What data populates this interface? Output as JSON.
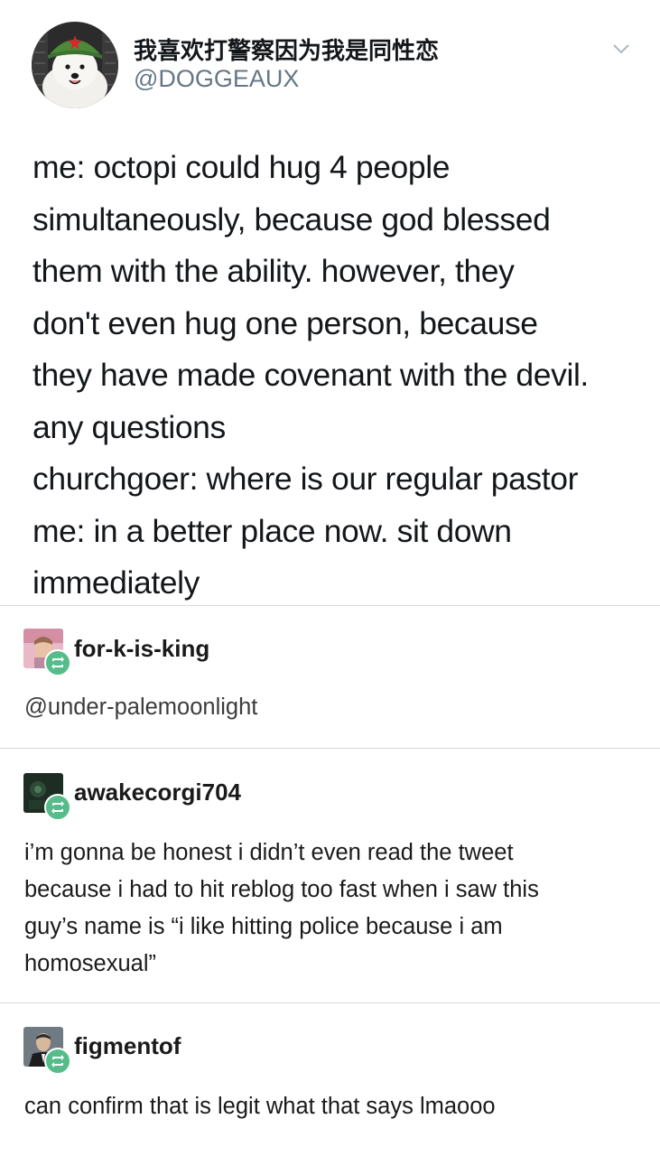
{
  "tweet": {
    "display_name": "我喜欢打警察因为我是同性恋",
    "handle": "@DOGGEAUX",
    "avatar_icon": "dog-wearing-red-star-cap-avatar",
    "menu_icon": "chevron-down-icon",
    "text_lines": [
      "me: octopi could hug 4 people",
      "simultaneously, because god blessed",
      "them with the ability. however, they",
      "don't even hug one person, because",
      "they have made covenant with the devil.",
      "any questions",
      "churchgoer: where is our regular pastor",
      "me: in a better place now. sit down",
      "immediately"
    ]
  },
  "reblogs": [
    {
      "username": "for-k-is-king",
      "body_lines": [],
      "mention": "@under-palemoonlight",
      "avatar_icon": "person-avatar",
      "badge_icon": "reblog-icon"
    },
    {
      "username": "awakecorgi704",
      "body_lines": [
        "i’m gonna be honest i didn’t even read the tweet",
        "because i had to hit reblog too fast when i saw this",
        "guy’s name is “i like hitting police because i am",
        "homosexual”"
      ],
      "avatar_icon": "dark-green-avatar",
      "badge_icon": "reblog-icon"
    },
    {
      "username": "figmentof",
      "body_lines": [
        "can confirm that is legit what that says lmaooo"
      ],
      "avatar_icon": "person-in-suit-avatar",
      "badge_icon": "reblog-icon"
    }
  ],
  "colors": {
    "reblog_badge": "#56bc8a",
    "handle_gray": "#657786",
    "divider": "#d9d9d9"
  }
}
